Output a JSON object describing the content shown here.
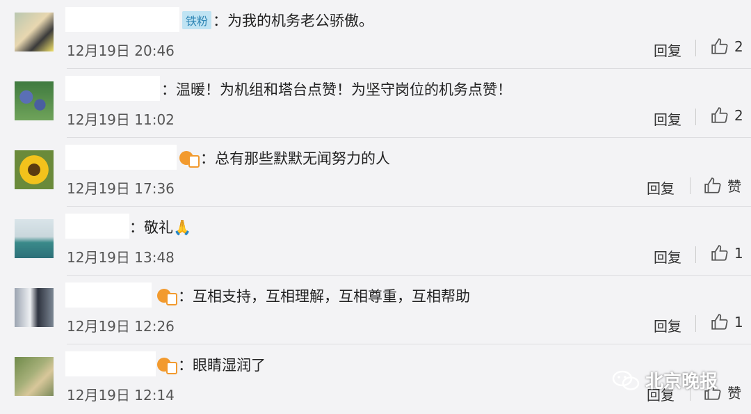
{
  "comments": [
    {
      "badge": "铁粉",
      "text": "：为我的机务老公骄傲。",
      "time": "12月19日 20:46",
      "reply": "回复",
      "like": "2"
    },
    {
      "badge": "",
      "text": "：温暖！为机组和塔台点赞！为坚守岗位的机务点赞！",
      "time": "12月19日 11:02",
      "reply": "回复",
      "like": "2"
    },
    {
      "badge": "",
      "text": "：总有那些默默无闻努力的人",
      "time": "12月19日 17:36",
      "reply": "回复",
      "like": "赞"
    },
    {
      "badge": "",
      "text": "：敬礼🙏",
      "time": "12月19日 13:48",
      "reply": "回复",
      "like": "1"
    },
    {
      "badge": "",
      "text": "：互相支持，互相理解，互相尊重，互相帮助",
      "time": "12月19日 12:26",
      "reply": "回复",
      "like": "1"
    },
    {
      "badge": "",
      "text": "：眼睛湿润了",
      "time": "12月19日 12:14",
      "reply": "回复",
      "like": "赞"
    }
  ],
  "watermark": "北京晚报",
  "colors": {
    "background": "#f3f3f5",
    "badge_bg": "#bfe3f3",
    "vip": "#f29a2e"
  }
}
